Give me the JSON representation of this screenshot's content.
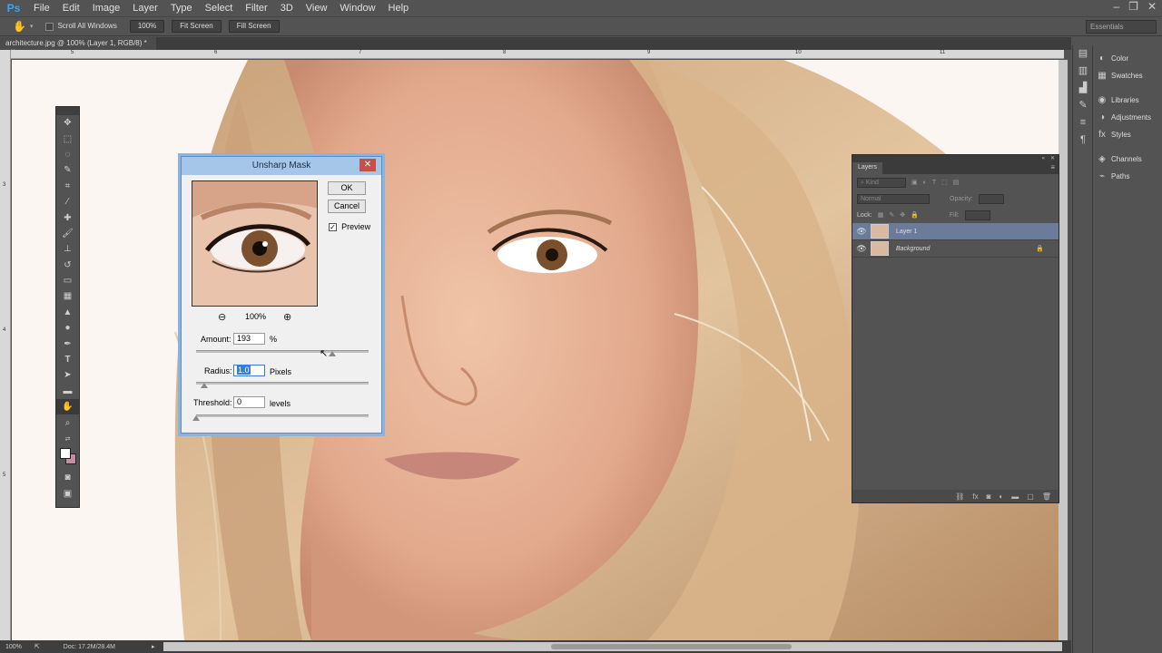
{
  "app": {
    "logo": "Ps"
  },
  "menu": [
    "File",
    "Edit",
    "Image",
    "Layer",
    "Type",
    "Select",
    "Filter",
    "3D",
    "View",
    "Window",
    "Help"
  ],
  "options": {
    "scroll_all_label": "Scroll All Windows",
    "zoom_btn": "100%",
    "fit_btn": "Fit Screen",
    "fill_btn": "Fill Screen",
    "workspace": "Essentials"
  },
  "document": {
    "tab_title": "architecture.jpg @ 100% (Layer 1, RGB/8) *",
    "close": "×"
  },
  "ruler": {
    "top": [
      "5",
      "6",
      "7",
      "8",
      "9",
      "10",
      "11"
    ],
    "left": [
      "3",
      "4",
      "5"
    ]
  },
  "status": {
    "zoom": "100%",
    "doc": "Doc: 17.2M/28.4M"
  },
  "dock": {
    "items": [
      "Color",
      "Swatches",
      "Libraries",
      "Adjustments",
      "Styles",
      "Channels",
      "Paths"
    ]
  },
  "layers_panel": {
    "tab": "Layers",
    "filter": "Kind",
    "blend_mode": "Normal",
    "opacity_label": "Opacity:",
    "lock_label": "Lock:",
    "fill_label": "Fill:",
    "layers": [
      {
        "name": "Layer 1",
        "selected": true
      },
      {
        "name": "Background",
        "selected": false
      }
    ]
  },
  "dialog": {
    "title": "Unsharp Mask",
    "ok": "OK",
    "cancel": "Cancel",
    "preview_label": "Preview",
    "preview_checked": true,
    "zoom": "100%",
    "amount_label": "Amount:",
    "amount_value": "193",
    "amount_unit": "%",
    "radius_label": "Radius:",
    "radius_value": "1.0",
    "radius_unit": "Pixels",
    "threshold_label": "Threshold:",
    "threshold_value": "0",
    "threshold_unit": "levels"
  },
  "colors": {
    "accent": "#31a8ff",
    "selected_layer": "#6b7c9b",
    "dialog_border": "#5a8fc8"
  }
}
